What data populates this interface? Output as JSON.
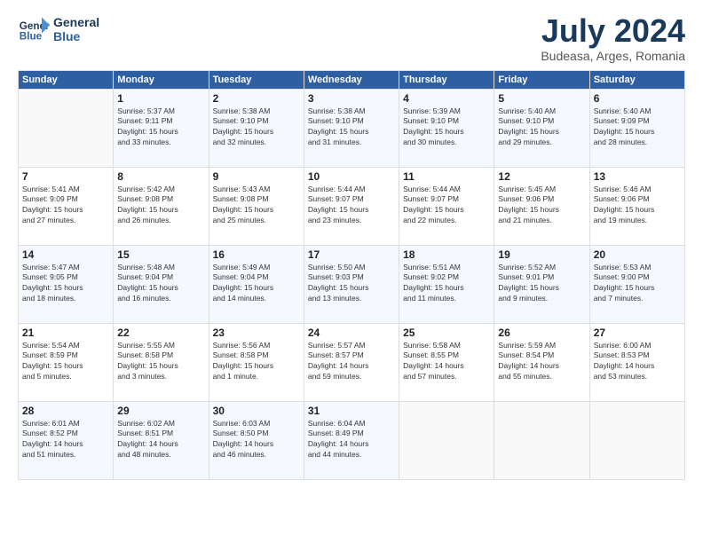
{
  "logo": {
    "line1": "General",
    "line2": "Blue"
  },
  "title": "July 2024",
  "location": "Budeasa, Arges, Romania",
  "days_of_week": [
    "Sunday",
    "Monday",
    "Tuesday",
    "Wednesday",
    "Thursday",
    "Friday",
    "Saturday"
  ],
  "weeks": [
    [
      {
        "day": "",
        "info": ""
      },
      {
        "day": "1",
        "info": "Sunrise: 5:37 AM\nSunset: 9:11 PM\nDaylight: 15 hours\nand 33 minutes."
      },
      {
        "day": "2",
        "info": "Sunrise: 5:38 AM\nSunset: 9:10 PM\nDaylight: 15 hours\nand 32 minutes."
      },
      {
        "day": "3",
        "info": "Sunrise: 5:38 AM\nSunset: 9:10 PM\nDaylight: 15 hours\nand 31 minutes."
      },
      {
        "day": "4",
        "info": "Sunrise: 5:39 AM\nSunset: 9:10 PM\nDaylight: 15 hours\nand 30 minutes."
      },
      {
        "day": "5",
        "info": "Sunrise: 5:40 AM\nSunset: 9:10 PM\nDaylight: 15 hours\nand 29 minutes."
      },
      {
        "day": "6",
        "info": "Sunrise: 5:40 AM\nSunset: 9:09 PM\nDaylight: 15 hours\nand 28 minutes."
      }
    ],
    [
      {
        "day": "7",
        "info": "Sunrise: 5:41 AM\nSunset: 9:09 PM\nDaylight: 15 hours\nand 27 minutes."
      },
      {
        "day": "8",
        "info": "Sunrise: 5:42 AM\nSunset: 9:08 PM\nDaylight: 15 hours\nand 26 minutes."
      },
      {
        "day": "9",
        "info": "Sunrise: 5:43 AM\nSunset: 9:08 PM\nDaylight: 15 hours\nand 25 minutes."
      },
      {
        "day": "10",
        "info": "Sunrise: 5:44 AM\nSunset: 9:07 PM\nDaylight: 15 hours\nand 23 minutes."
      },
      {
        "day": "11",
        "info": "Sunrise: 5:44 AM\nSunset: 9:07 PM\nDaylight: 15 hours\nand 22 minutes."
      },
      {
        "day": "12",
        "info": "Sunrise: 5:45 AM\nSunset: 9:06 PM\nDaylight: 15 hours\nand 21 minutes."
      },
      {
        "day": "13",
        "info": "Sunrise: 5:46 AM\nSunset: 9:06 PM\nDaylight: 15 hours\nand 19 minutes."
      }
    ],
    [
      {
        "day": "14",
        "info": "Sunrise: 5:47 AM\nSunset: 9:05 PM\nDaylight: 15 hours\nand 18 minutes."
      },
      {
        "day": "15",
        "info": "Sunrise: 5:48 AM\nSunset: 9:04 PM\nDaylight: 15 hours\nand 16 minutes."
      },
      {
        "day": "16",
        "info": "Sunrise: 5:49 AM\nSunset: 9:04 PM\nDaylight: 15 hours\nand 14 minutes."
      },
      {
        "day": "17",
        "info": "Sunrise: 5:50 AM\nSunset: 9:03 PM\nDaylight: 15 hours\nand 13 minutes."
      },
      {
        "day": "18",
        "info": "Sunrise: 5:51 AM\nSunset: 9:02 PM\nDaylight: 15 hours\nand 11 minutes."
      },
      {
        "day": "19",
        "info": "Sunrise: 5:52 AM\nSunset: 9:01 PM\nDaylight: 15 hours\nand 9 minutes."
      },
      {
        "day": "20",
        "info": "Sunrise: 5:53 AM\nSunset: 9:00 PM\nDaylight: 15 hours\nand 7 minutes."
      }
    ],
    [
      {
        "day": "21",
        "info": "Sunrise: 5:54 AM\nSunset: 8:59 PM\nDaylight: 15 hours\nand 5 minutes."
      },
      {
        "day": "22",
        "info": "Sunrise: 5:55 AM\nSunset: 8:58 PM\nDaylight: 15 hours\nand 3 minutes."
      },
      {
        "day": "23",
        "info": "Sunrise: 5:56 AM\nSunset: 8:58 PM\nDaylight: 15 hours\nand 1 minute."
      },
      {
        "day": "24",
        "info": "Sunrise: 5:57 AM\nSunset: 8:57 PM\nDaylight: 14 hours\nand 59 minutes."
      },
      {
        "day": "25",
        "info": "Sunrise: 5:58 AM\nSunset: 8:55 PM\nDaylight: 14 hours\nand 57 minutes."
      },
      {
        "day": "26",
        "info": "Sunrise: 5:59 AM\nSunset: 8:54 PM\nDaylight: 14 hours\nand 55 minutes."
      },
      {
        "day": "27",
        "info": "Sunrise: 6:00 AM\nSunset: 8:53 PM\nDaylight: 14 hours\nand 53 minutes."
      }
    ],
    [
      {
        "day": "28",
        "info": "Sunrise: 6:01 AM\nSunset: 8:52 PM\nDaylight: 14 hours\nand 51 minutes."
      },
      {
        "day": "29",
        "info": "Sunrise: 6:02 AM\nSunset: 8:51 PM\nDaylight: 14 hours\nand 48 minutes."
      },
      {
        "day": "30",
        "info": "Sunrise: 6:03 AM\nSunset: 8:50 PM\nDaylight: 14 hours\nand 46 minutes."
      },
      {
        "day": "31",
        "info": "Sunrise: 6:04 AM\nSunset: 8:49 PM\nDaylight: 14 hours\nand 44 minutes."
      },
      {
        "day": "",
        "info": ""
      },
      {
        "day": "",
        "info": ""
      },
      {
        "day": "",
        "info": ""
      }
    ]
  ]
}
